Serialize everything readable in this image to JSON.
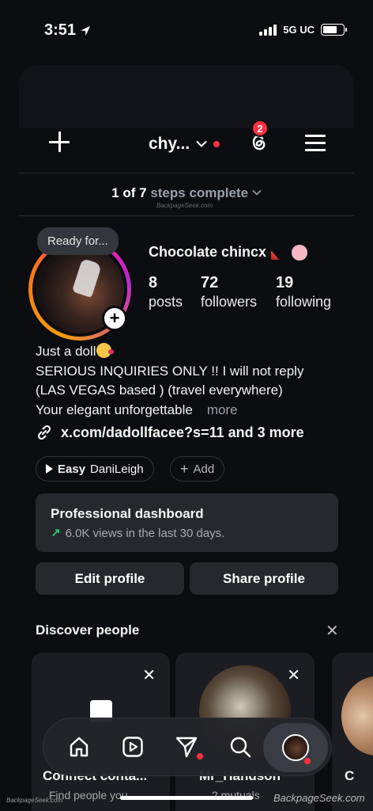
{
  "status_bar": {
    "time": "3:51",
    "network": "5G UC"
  },
  "header": {
    "username": "chy...",
    "threads_badge": "2"
  },
  "steps": {
    "progress": "1 of 7",
    "suffix": "steps complete"
  },
  "watermark_small": "BackpageSeek.com",
  "profile": {
    "note": "Ready for...",
    "display_name": "Chocolate chincx",
    "stats": [
      {
        "value": "8",
        "label": "posts"
      },
      {
        "value": "72",
        "label": "followers"
      },
      {
        "value": "19",
        "label": "following"
      }
    ],
    "bio_lines": [
      "Just a doll",
      "SERIOUS INQUIRIES ONLY !! I will not reply",
      "(LAS VEGAS based ) (travel everywhere)",
      "Your elegant unforgettable"
    ],
    "bio_more": "more",
    "link": "x.com/dadollfacee?s=11 and 3 more"
  },
  "chips": {
    "music_title": "Easy",
    "music_artist": "DaniLeigh",
    "add": "Add"
  },
  "dashboard": {
    "title": "Professional dashboard",
    "subtitle": "6.0K views in the last 30 days."
  },
  "buttons": {
    "edit": "Edit profile",
    "share": "Share profile"
  },
  "discover": {
    "title": "Discover people",
    "cards": [
      {
        "title": "Connect conta...",
        "subtitle": "Find people you..."
      },
      {
        "title": "Mr_Handson",
        "subtitle": "2 mutuals"
      },
      {
        "title": "C",
        "subtitle": ""
      }
    ]
  },
  "watermark_corner": "BackpageSeek.com",
  "watermark_left": "BackpageSeek.com",
  "icons": {
    "nav": [
      "home-icon",
      "reels-icon",
      "send-icon",
      "search-icon",
      "profile-avatar-icon"
    ]
  },
  "colors": {
    "accent_red": "#ff3040",
    "background": "#0c0d10",
    "card": "#26282e",
    "growth_green": "#33d17a"
  }
}
